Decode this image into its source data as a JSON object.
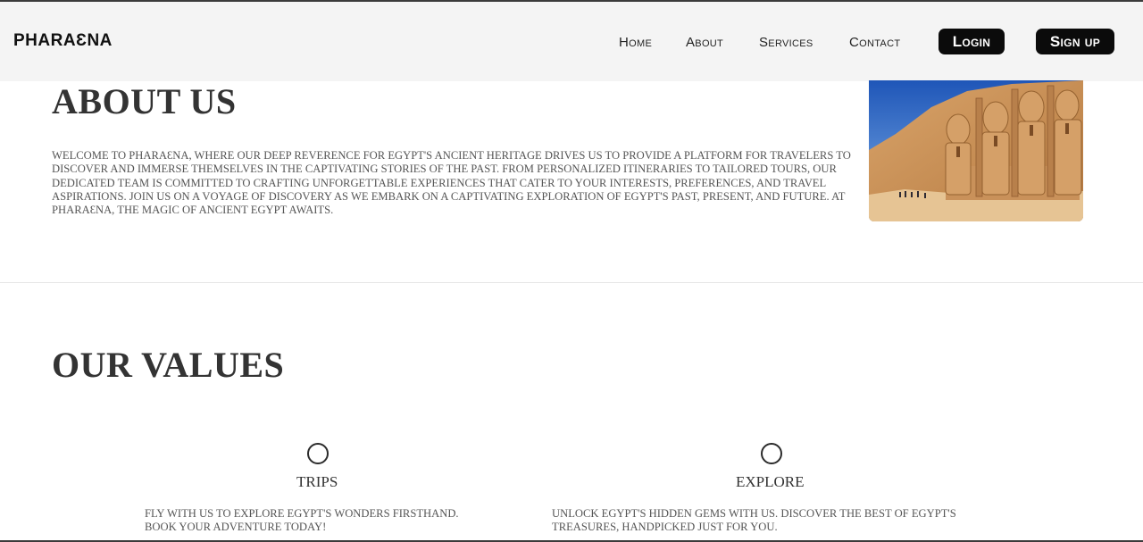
{
  "nav": {
    "brand": "PHARAƐNA",
    "links": [
      "Home",
      "About",
      "Services",
      "Contact"
    ],
    "login_label": "Login",
    "signup_label": "Sign up"
  },
  "about": {
    "title": "ABOUT US",
    "text": "Welcome to Pharaɛna, where our deep reverence for Egypt's ancient heritage drives us to provide a platform for travelers to discover and immerse themselves in the captivating stories of the past. From personalized itineraries to tailored tours, our dedicated team is committed to crafting unforgettable experiences that cater to your interests, preferences, and travel aspirations. Join us on a voyage of discovery as we embark on a captivating exploration of Egypt's past, present, and future. At Pharaɛna, the magic of ancient Egypt awaits."
  },
  "values": {
    "title": "OUR VALUES",
    "items": [
      {
        "icon": "circle-icon",
        "title": "TRIPS",
        "text": "Fly with us to explore Egypt's wonders firsthand. Book your adventure today!"
      },
      {
        "icon": "circle-icon",
        "title": "EXPLORE",
        "text": "Unlock Egypt's hidden gems with us. Discover the best of Egypt's treasures, handpicked just for you."
      }
    ]
  },
  "colors": {
    "navbar_bg": "#f4f4f4",
    "button_bg": "#0b0b0b",
    "text": "#333333"
  }
}
